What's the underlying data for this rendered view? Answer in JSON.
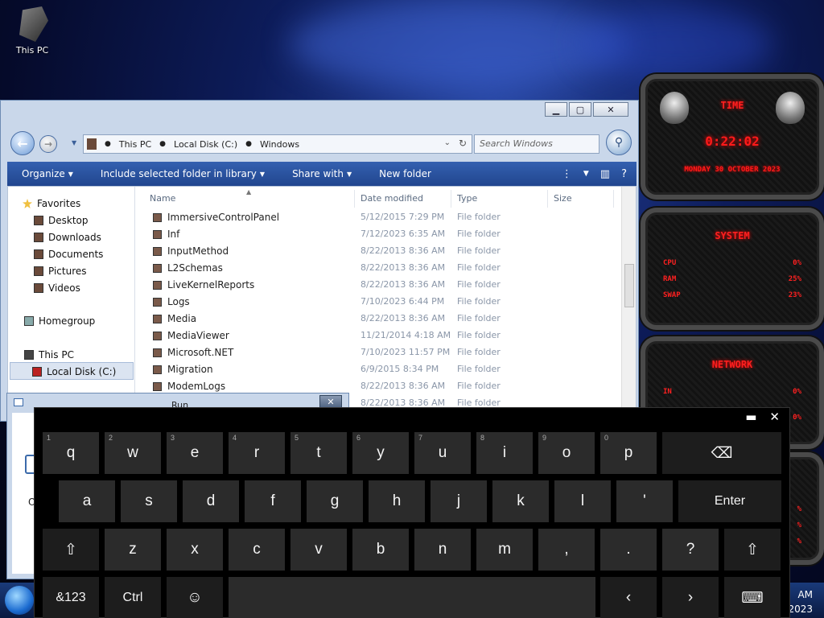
{
  "desktop": {
    "icon_label": "This PC"
  },
  "explorer": {
    "address": [
      "This PC",
      "Local Disk (C:)",
      "Windows"
    ],
    "search_placeholder": "Search Windows",
    "toolbar": {
      "organize": "Organize",
      "include": "Include selected folder in library",
      "share": "Share with",
      "new_folder": "New folder"
    },
    "nav": {
      "favorites": "Favorites",
      "desktop": "Desktop",
      "downloads": "Downloads",
      "documents": "Documents",
      "pictures": "Pictures",
      "videos": "Videos",
      "homegroup": "Homegroup",
      "this_pc": "This PC",
      "local_disk": "Local Disk (C:)"
    },
    "columns": {
      "name": "Name",
      "date": "Date modified",
      "type": "Type",
      "size": "Size"
    },
    "rows": [
      {
        "name": "ImmersiveControlPanel",
        "date": "5/12/2015 7:29 PM",
        "type": "File folder"
      },
      {
        "name": "Inf",
        "date": "7/12/2023 6:35 AM",
        "type": "File folder"
      },
      {
        "name": "InputMethod",
        "date": "8/22/2013 8:36 AM",
        "type": "File folder"
      },
      {
        "name": "L2Schemas",
        "date": "8/22/2013 8:36 AM",
        "type": "File folder"
      },
      {
        "name": "LiveKernelReports",
        "date": "8/22/2013 8:36 AM",
        "type": "File folder"
      },
      {
        "name": "Logs",
        "date": "7/10/2023 6:44 PM",
        "type": "File folder"
      },
      {
        "name": "Media",
        "date": "8/22/2013 8:36 AM",
        "type": "File folder"
      },
      {
        "name": "MediaViewer",
        "date": "11/21/2014 4:18 AM",
        "type": "File folder"
      },
      {
        "name": "Microsoft.NET",
        "date": "7/10/2023 11:57 PM",
        "type": "File folder"
      },
      {
        "name": "Migration",
        "date": "6/9/2015 8:34 PM",
        "type": "File folder"
      },
      {
        "name": "ModemLogs",
        "date": "8/22/2013 8:36 AM",
        "type": "File folder"
      },
      {
        "name": "",
        "date": "8/22/2013 8:36 AM",
        "type": "File folder"
      }
    ]
  },
  "run": {
    "title": "Run",
    "open_label": "Op"
  },
  "gadget": {
    "time_title": "TIME",
    "time": "0:22:02",
    "date": "MONDAY 30 OCTOBER 2023",
    "system_title": "SYSTEM",
    "cpu_label": "CPU",
    "cpu_val": "0%",
    "ram_label": "RAM",
    "ram_val": "25%",
    "swap_label": "SWAP",
    "swap_val": "23%",
    "network_title": "NETWORK",
    "in_label": "IN",
    "in_val": "0%",
    "out_val": "0%",
    "g4_val1": "%",
    "g4_val2": "%",
    "g4_val3": "%"
  },
  "keyboard": {
    "row1": [
      {
        "k": "q",
        "n": "1"
      },
      {
        "k": "w",
        "n": "2"
      },
      {
        "k": "e",
        "n": "3"
      },
      {
        "k": "r",
        "n": "4"
      },
      {
        "k": "t",
        "n": "5"
      },
      {
        "k": "y",
        "n": "6"
      },
      {
        "k": "u",
        "n": "7"
      },
      {
        "k": "i",
        "n": "8"
      },
      {
        "k": "o",
        "n": "9"
      },
      {
        "k": "p",
        "n": "0"
      }
    ],
    "backspace": "⌫",
    "row2": [
      "a",
      "s",
      "d",
      "f",
      "g",
      "h",
      "j",
      "k",
      "l",
      "'"
    ],
    "enter": "Enter",
    "row3": [
      "z",
      "x",
      "c",
      "v",
      "b",
      "n",
      "m",
      ",",
      ".",
      "?"
    ],
    "shift": "⇧",
    "amp123": "&123",
    "ctrl": "Ctrl",
    "emoji": "☺",
    "left": "‹",
    "right": "›",
    "kbd_icon": "⌨",
    "minimize": "▬",
    "close": "✕"
  },
  "taskbar": {
    "clock_time": "AM",
    "clock_date": "/2023"
  },
  "colors": {
    "toolbar": "#2b55a0",
    "gadget_red": "#ff1a1a",
    "key": "#2b2b2b"
  }
}
